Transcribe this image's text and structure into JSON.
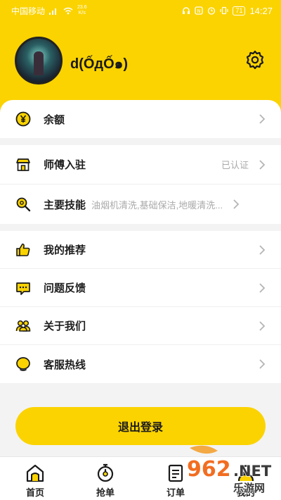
{
  "status_bar": {
    "carrier": "中国移动",
    "speed": "23.6",
    "speed_unit": "K/s",
    "battery": "71",
    "time": "14:27"
  },
  "profile": {
    "username": "d(ỐдỐ๑)"
  },
  "menu": {
    "balance": {
      "label": "余额"
    },
    "master_entry": {
      "label": "师傅入驻",
      "value": "已认证"
    },
    "main_skills": {
      "label": "主要技能",
      "value": "油烟机清洗,基础保洁,地暖清洗..."
    },
    "my_referrals": {
      "label": "我的推荐"
    },
    "feedback": {
      "label": "问题反馈"
    },
    "about_us": {
      "label": "关于我们"
    },
    "hotline": {
      "label": "客服热线"
    }
  },
  "logout": {
    "label": "退出登录"
  },
  "tabbar": [
    {
      "label": "首页",
      "icon": "home-icon"
    },
    {
      "label": "抢单",
      "icon": "stopwatch-icon"
    },
    {
      "label": "订单",
      "icon": "order-icon"
    },
    {
      "label": "我的",
      "icon": "user-icon"
    }
  ],
  "watermark": {
    "text": "962.NET",
    "subtext": "乐游网"
  },
  "colors": {
    "accent": "#fbd300",
    "background": "#f3f3f3"
  }
}
